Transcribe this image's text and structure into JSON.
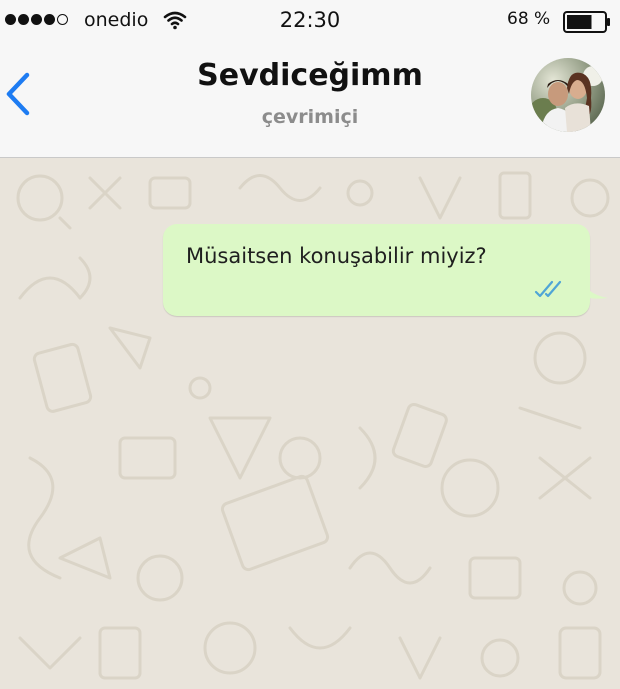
{
  "status_bar": {
    "carrier": "onedio",
    "time": "22:30",
    "battery_percent": "68 %",
    "battery_level": 0.68,
    "signal_bars_filled": 4,
    "signal_bars_total": 5
  },
  "header": {
    "back_icon": "chevron-left-icon",
    "contact_name": "Sevdiceğimm",
    "contact_status": "çevrimiçi",
    "accent_color": "#1e7cf2"
  },
  "messages": [
    {
      "direction": "outgoing",
      "text": "Müsaitsen konuşabilir miyiz?",
      "status_icon": "double-check-icon",
      "bubble_color": "#dcf8c6",
      "tick_color": "#4fa5d6"
    }
  ]
}
